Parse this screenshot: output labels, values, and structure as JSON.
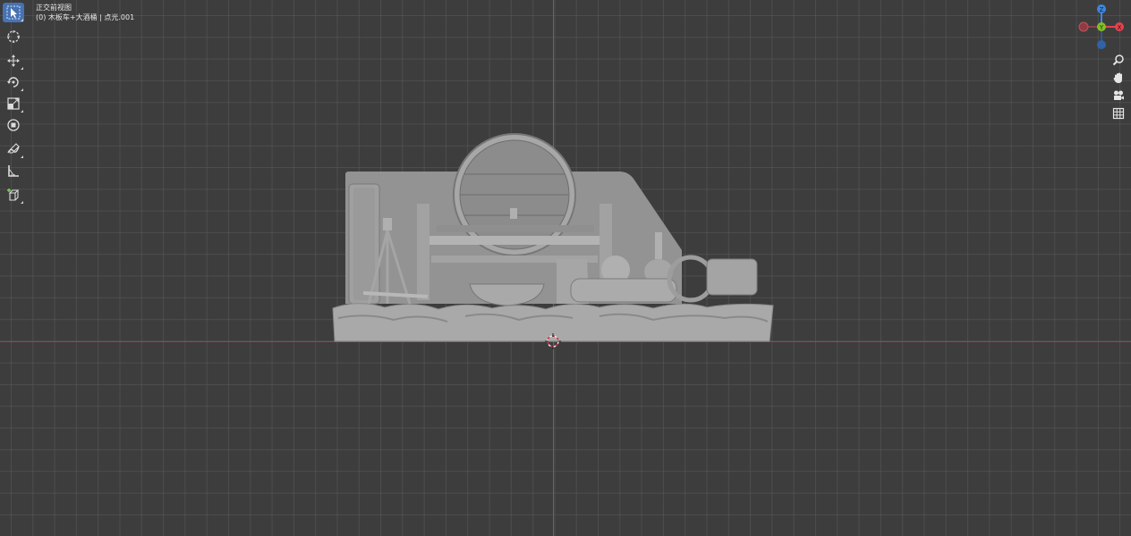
{
  "viewport": {
    "view_name": "正交前视图",
    "collection_info": "(0) 木板车+大酒桶 | 点光.001"
  },
  "toolbar": {
    "tools": [
      {
        "name": "select-box",
        "active": true
      },
      {
        "name": "cursor",
        "active": false
      },
      {
        "name": "move",
        "active": false
      },
      {
        "name": "rotate",
        "active": false
      },
      {
        "name": "scale",
        "active": false
      },
      {
        "name": "transform",
        "active": false
      },
      {
        "name": "annotate",
        "active": false
      },
      {
        "name": "measure",
        "active": false
      },
      {
        "name": "add-cube",
        "active": false
      }
    ]
  },
  "gizmo": {
    "z_label": "Z",
    "y_label": "Y",
    "x_label": "X",
    "colors": {
      "x": "#e2434f",
      "y": "#7fbf2a",
      "z": "#3f86e0"
    }
  },
  "navigation": {
    "buttons": [
      "zoom-icon",
      "hand-pan-icon",
      "camera-icon",
      "grid-icon"
    ]
  },
  "colors": {
    "background": "#3d3d3d",
    "axis_x": "#b03a48",
    "axis_z": "#2e6fbf",
    "active_tool": "#4772b3"
  }
}
